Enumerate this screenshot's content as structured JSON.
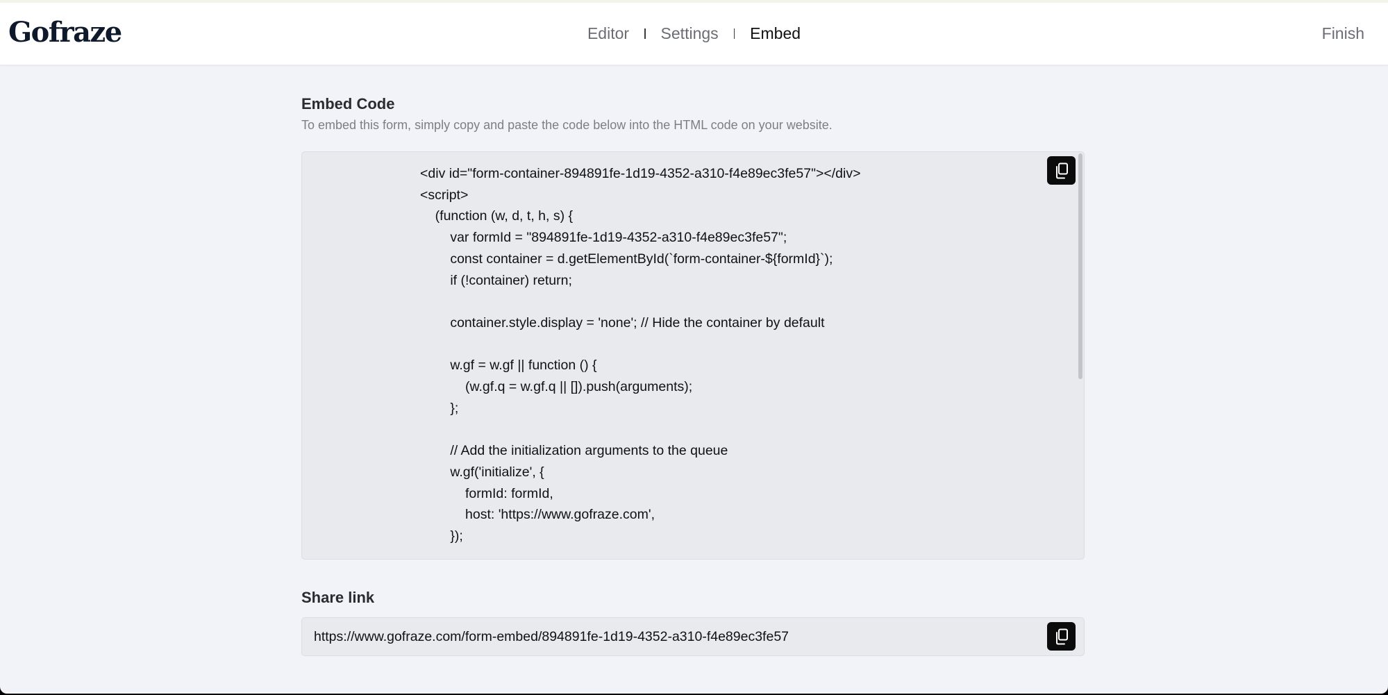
{
  "header": {
    "logo": "Gofraze",
    "nav": [
      {
        "label": "Editor",
        "active": false
      },
      {
        "label": "Settings",
        "active": false
      },
      {
        "label": "Embed",
        "active": true
      }
    ],
    "finish_label": "Finish"
  },
  "embed": {
    "title": "Embed Code",
    "description": "To embed this form, simply copy and paste the code below into the HTML code on your website.",
    "code_lines": [
      "<div id=\"form-container-894891fe-1d19-4352-a310-f4e89ec3fe57\"></div>",
      "<script>",
      "    (function (w, d, t, h, s) {",
      "        var formId = \"894891fe-1d19-4352-a310-f4e89ec3fe57\";",
      "        const container = d.getElementById(`form-container-${formId}`);",
      "        if (!container) return;",
      "",
      "        container.style.display = 'none'; // Hide the container by default",
      "",
      "        w.gf = w.gf || function () {",
      "            (w.gf.q = w.gf.q || []).push(arguments);",
      "        };",
      "",
      "        // Add the initialization arguments to the queue",
      "        w.gf('initialize', {",
      "            formId: formId,",
      "            host: 'https://www.gofraze.com',",
      "        });"
    ],
    "copy_icon": "copy-icon"
  },
  "share": {
    "title": "Share link",
    "url": "https://www.gofraze.com/form-embed/894891fe-1d19-4352-a310-f4e89ec3fe57",
    "copy_icon": "copy-icon"
  }
}
